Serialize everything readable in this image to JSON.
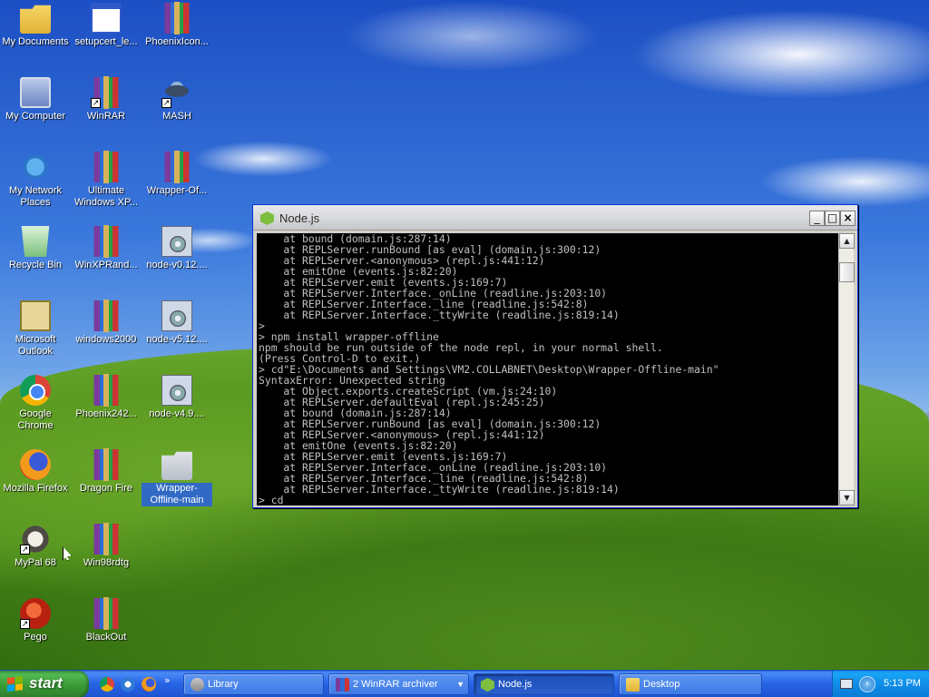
{
  "desktop": {
    "icons": [
      {
        "label": "My Documents",
        "icon": "my-documents-icon"
      },
      {
        "label": "setupcert_le...",
        "icon": "window-icon"
      },
      {
        "label": "PhoenixIcon...",
        "icon": "winrar-archive-icon"
      },
      {
        "label": "My Computer",
        "icon": "my-computer-icon"
      },
      {
        "label": "WinRAR",
        "icon": "winrar-archive-icon"
      },
      {
        "label": "MASH",
        "icon": "mash-icon"
      },
      {
        "label": "My Network Places",
        "icon": "network-places-icon"
      },
      {
        "label": "Ultimate Windows XP...",
        "icon": "winrar-archive-icon"
      },
      {
        "label": "Wrapper-Of...",
        "icon": "winrar-archive-icon"
      },
      {
        "label": "Recycle Bin",
        "icon": "recycle-bin-icon"
      },
      {
        "label": "WinXPRand...",
        "icon": "winrar-archive-icon"
      },
      {
        "label": "node-v0.12....",
        "icon": "installer-icon"
      },
      {
        "label": "Microsoft Outlook",
        "icon": "outlook-icon"
      },
      {
        "label": "windows2000",
        "icon": "winrar-archive-icon"
      },
      {
        "label": "node-v5.12....",
        "icon": "installer-icon"
      },
      {
        "label": "Google Chrome",
        "icon": "chrome-icon"
      },
      {
        "label": "Phoenix242...",
        "icon": "winrar-archive-icon"
      },
      {
        "label": "node-v4.9....",
        "icon": "installer-icon"
      },
      {
        "label": "Mozilla Firefox",
        "icon": "firefox-icon"
      },
      {
        "label": "Dragon Fire",
        "icon": "winrar-archive-icon"
      },
      {
        "label": "Wrapper-Offline-main",
        "icon": "folder-icon"
      },
      {
        "label": "MyPal 68",
        "icon": "mypal-icon"
      },
      {
        "label": "Win98rdtg",
        "icon": "winrar-archive-icon"
      },
      {
        "label": "Pego",
        "icon": "pego-icon"
      },
      {
        "label": "BlackOut",
        "icon": "winrar-archive-icon"
      }
    ]
  },
  "window": {
    "title": "Node.js",
    "controls": {
      "minimize": "_",
      "maximize": "□",
      "close": "×"
    },
    "console_lines": [
      "    at bound (domain.js:287:14)",
      "    at REPLServer.runBound [as eval] (domain.js:300:12)",
      "    at REPLServer.<anonymous> (repl.js:441:12)",
      "    at emitOne (events.js:82:20)",
      "    at REPLServer.emit (events.js:169:7)",
      "    at REPLServer.Interface._onLine (readline.js:203:10)",
      "    at REPLServer.Interface._line (readline.js:542:8)",
      "    at REPLServer.Interface._ttyWrite (readline.js:819:14)",
      ">",
      "> npm install wrapper-offline",
      "npm should be run outside of the node repl, in your normal shell.",
      "(Press Control-D to exit.)",
      "> cd\"E:\\Documents and Settings\\VM2.COLLABNET\\Desktop\\Wrapper-Offline-main\"",
      "SyntaxError: Unexpected string",
      "    at Object.exports.createScript (vm.js:24:10)",
      "    at REPLServer.defaultEval (repl.js:245:25)",
      "    at bound (domain.js:287:14)",
      "    at REPLServer.runBound [as eval] (domain.js:300:12)",
      "    at REPLServer.<anonymous> (repl.js:441:12)",
      "    at emitOne (events.js:82:20)",
      "    at REPLServer.emit (events.js:169:7)",
      "    at REPLServer.Interface._onLine (readline.js:203:10)",
      "    at REPLServer.Interface._line (readline.js:542:8)",
      "    at REPLServer.Interface._ttyWrite (readline.js:819:14)",
      "> cd"
    ],
    "scrollbar": {
      "up": "▲",
      "down": "▼"
    }
  },
  "taskbar": {
    "start_label": "start",
    "quick_launch_more": "»",
    "tasks": [
      {
        "label": "Library",
        "icon": "library-icon"
      },
      {
        "label": "2 WinRAR archiver",
        "icon": "winrar-icon",
        "group_arrow": "▼"
      },
      {
        "label": "Node.js",
        "icon": "nodejs-icon",
        "active": true
      },
      {
        "label": "Desktop",
        "icon": "folder-icon"
      }
    ],
    "tray_arrow": "‹",
    "clock": "5:13 PM"
  }
}
